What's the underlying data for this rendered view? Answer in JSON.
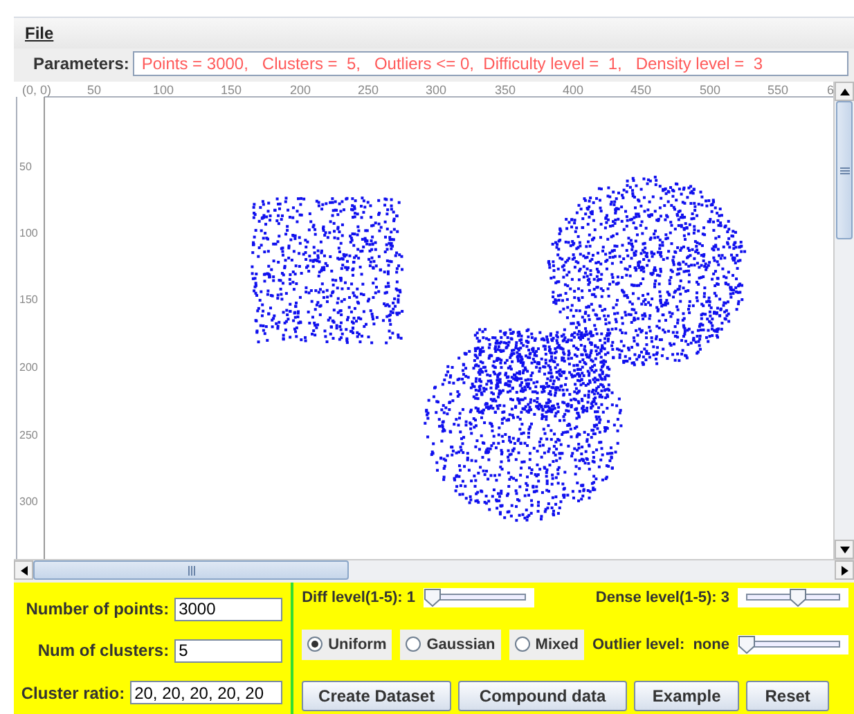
{
  "menu": [
    "File"
  ],
  "parameters": {
    "label": "Parameters:",
    "value": "Points = 3000,   Clusters =  5,   Outliers <= 0,  Difficulty level =  1,   Density level =  3"
  },
  "plot": {
    "x_ticks": [
      "(0, 0)",
      "50",
      "100",
      "150",
      "200",
      "250",
      "300",
      "350",
      "400",
      "450",
      "500",
      "550",
      "6"
    ],
    "y_ticks": [
      "50",
      "100",
      "150",
      "200",
      "250",
      "300"
    ]
  },
  "fields": [
    {
      "label": "Number of points:",
      "value": "3000"
    },
    {
      "label": "Num of clusters:",
      "value": "5"
    },
    {
      "label": "Cluster ratio:",
      "value": "20, 20, 20, 20, 20"
    }
  ],
  "sliders": [
    {
      "label": "Diff level(1-5): 1",
      "level": 0
    },
    {
      "label": "Dense level(1-5): 3",
      "level": 0.55
    }
  ],
  "distributions": [
    {
      "label": "Uniform",
      "selected": true
    },
    {
      "label": "Gaussian",
      "selected": false
    },
    {
      "label": "Mixed",
      "selected": false
    }
  ],
  "outlier": {
    "label": "Outlier level:  none",
    "level": 0
  },
  "buttons": [
    "Create Dataset",
    "Compound data",
    "Example",
    "Reset"
  ]
}
